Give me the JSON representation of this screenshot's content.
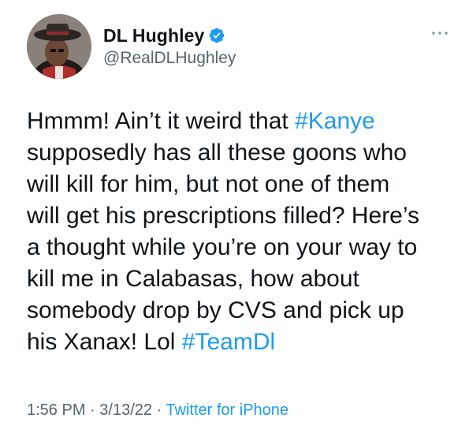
{
  "user": {
    "display_name": "DL Hughley",
    "handle": "@RealDLHughley",
    "verified": true
  },
  "icons": {
    "verified": "verified-badge-icon",
    "more": "more-options-icon",
    "avatar": "profile-avatar"
  },
  "tweet": {
    "lines": [
      [
        {
          "text": "Hmmm! Ain’t it weird that "
        },
        {
          "text": "#Kanye",
          "hashtag": true
        }
      ],
      [
        {
          "text": "supposedly has all these goons who"
        }
      ],
      [
        {
          "text": "will kill for him, but not one of them"
        }
      ],
      [
        {
          "text": "will get his prescriptions filled? Here’s"
        }
      ],
      [
        {
          "text": "a thought while you’re on your way to"
        }
      ],
      [
        {
          "text": "kill me in Calabasas, how about"
        }
      ],
      [
        {
          "text": "somebody drop by CVS and pick up"
        }
      ],
      [
        {
          "text": "his Xanax! Lol "
        },
        {
          "text": "#TeamDl",
          "hashtag": true
        }
      ]
    ]
  },
  "meta": {
    "time": "1:56 PM",
    "separator": " · ",
    "date": "3/13/22",
    "source": "Twitter for iPhone"
  },
  "colors": {
    "text": "#0f1419",
    "secondary": "#536471",
    "accent": "#1d9bf0"
  }
}
